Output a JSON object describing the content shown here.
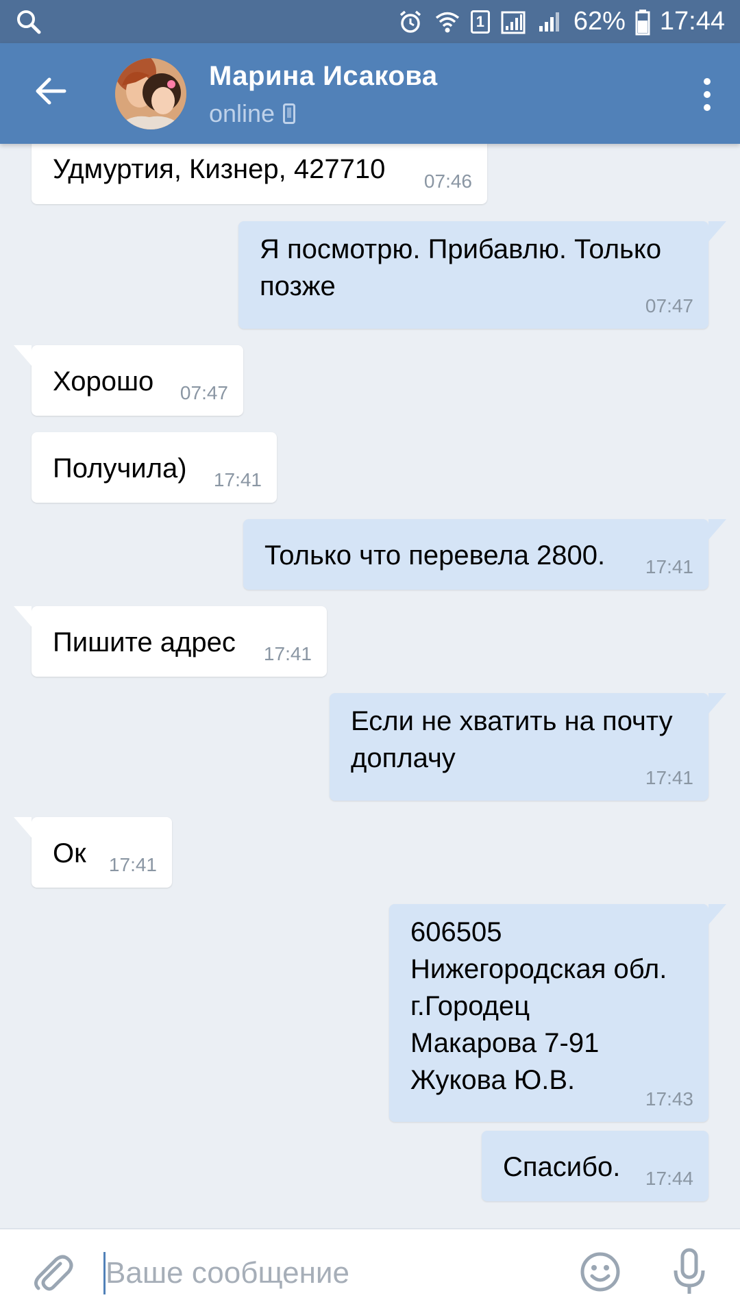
{
  "status_bar": {
    "sim_slot": "1",
    "battery": "62%",
    "time": "17:44",
    "icons": [
      "search-icon",
      "alarm-icon",
      "wifi-icon",
      "sim-icon",
      "signal-icon",
      "signal-icon",
      "battery-icon"
    ]
  },
  "header": {
    "name": "Марина Исакова",
    "status": "online",
    "back_icon": "arrow-left-icon",
    "menu_icon": "more-vertical-icon"
  },
  "messages": [
    {
      "direction": "in",
      "text": "Удмуртия, Кизнер, 427710",
      "time": "07:46"
    },
    {
      "direction": "out",
      "text": "Я посмотрю. Прибавлю. Только\nпозже",
      "time": "07:47"
    },
    {
      "direction": "in",
      "text": "Хорошо",
      "time": "07:47"
    },
    {
      "direction": "in",
      "text": "Получила)",
      "time": "17:41"
    },
    {
      "direction": "out",
      "text": "Только что перевела 2800.",
      "time": "17:41"
    },
    {
      "direction": "in",
      "text": "Пишите адрес",
      "time": "17:41"
    },
    {
      "direction": "out",
      "text": "Если не хватить на почту\nдоплачу",
      "time": "17:41"
    },
    {
      "direction": "in",
      "text": "Ок",
      "time": "17:41"
    },
    {
      "direction": "out",
      "text": "606505\nНижегородская обл.\nг.Городец\nМакарова 7-91\nЖукова Ю.В.",
      "time": "17:43"
    },
    {
      "direction": "out",
      "text": "Спасибо.",
      "time": "17:44"
    }
  ],
  "input": {
    "placeholder": "Ваше сообщение",
    "value": ""
  },
  "colors": {
    "status_bar": "#4e6f98",
    "header": "#5181b8",
    "background": "#ebeff4",
    "incoming_bubble": "#ffffff",
    "outgoing_bubble": "#d5e4f6",
    "time_text": "#8a96a3"
  }
}
